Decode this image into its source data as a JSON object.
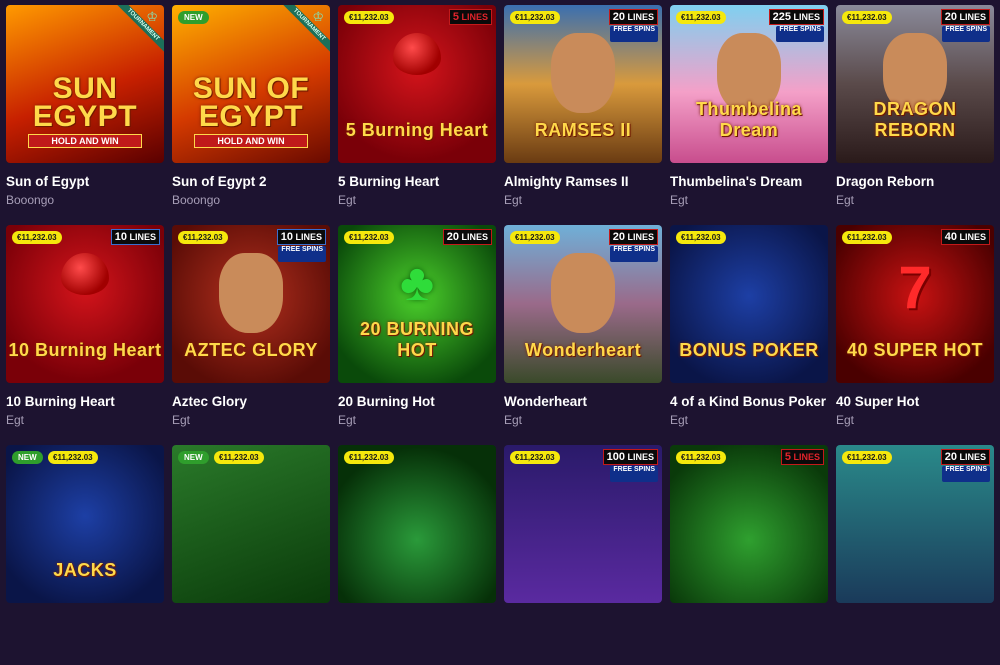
{
  "games": [
    {
      "title": "Sun of Egypt",
      "provider": "Booongo",
      "logo": "SUN EGYPT",
      "logo_sub": "HOLD AND WIN",
      "tournament": "TOURNAMENT",
      "bg": "linear-gradient(160deg,#ff9a00,#c72000 55%,#5a0000)"
    },
    {
      "title": "Sun of Egypt 2",
      "provider": "Booongo",
      "logo": "SUN OF EGYPT",
      "logo_sub": "HOLD AND WIN",
      "tournament": "TOURNAMENT",
      "new": "NEW",
      "bg": "linear-gradient(160deg,#ffb000,#d43a00 55%,#6a0a00)"
    },
    {
      "title": "5 Burning Heart",
      "provider": "Egt",
      "jackpot": "€11,232.03",
      "lines_num": "5",
      "lines_word": "LINES",
      "lines_style": "red",
      "logo": "5 Burning Heart",
      "bg": "radial-gradient(circle at 50% 40%,#d4141b,#7a0008 75%)",
      "fig": "heart"
    },
    {
      "title": "Almighty Ramses II",
      "provider": "Egt",
      "jackpot": "€11,232.03",
      "lines_num": "20",
      "lines_word": "LINES",
      "free": "FREE SPINS",
      "logo": "RAMSES II",
      "bg": "linear-gradient(180deg,#3a6fb0,#d99a3c 50%,#6a3b12)",
      "fig": "face"
    },
    {
      "title": "Thumbelina's Dream",
      "provider": "Egt",
      "jackpot": "€11,232.03",
      "lines_num": "225",
      "lines_word": "LINES",
      "free": "FREE SPINS",
      "logo": "Thumbelina Dream",
      "bg": "linear-gradient(180deg,#7fd0f0,#f4a0c8 55%,#c84d8d)",
      "fig": "face"
    },
    {
      "title": "Dragon Reborn",
      "provider": "Egt",
      "jackpot": "€11,232.03",
      "lines_num": "20",
      "lines_word": "LINES",
      "free": "FREE SPINS",
      "logo": "DRAGON REBORN",
      "bg": "linear-gradient(180deg,#8a8a9a,#5a4a4a 50%,#2a1a1a)",
      "fig": "face"
    },
    {
      "title": "10 Burning Heart",
      "provider": "Egt",
      "jackpot": "€11,232.03",
      "lines_num": "10",
      "lines_word": "LINES",
      "lines_style": "blue",
      "logo": "10 Burning Heart",
      "bg": "radial-gradient(circle at 50% 40%,#d4141b,#7a0008 75%)",
      "fig": "heart"
    },
    {
      "title": "Aztec Glory",
      "provider": "Egt",
      "jackpot": "€11,232.03",
      "lines_num": "10",
      "lines_word": "LINES",
      "lines_style": "blue",
      "free": "FREE SPINS",
      "logo": "AZTEC GLORY",
      "bg": "radial-gradient(circle at 50% 45%,#b3301e,#5a0c06 80%)",
      "fig": "face"
    },
    {
      "title": "20 Burning Hot",
      "provider": "Egt",
      "jackpot": "€11,232.03",
      "lines_num": "20",
      "lines_word": "LINES",
      "logo": "20 BURNING HOT",
      "bg": "radial-gradient(circle at 50% 45%,#4bd02b,#0a4a0a 80%)",
      "fig": "clover"
    },
    {
      "title": "Wonderheart",
      "provider": "Egt",
      "jackpot": "€11,232.03",
      "lines_num": "20",
      "lines_word": "LINES",
      "free": "FREE SPINS",
      "logo": "Wonderheart",
      "bg": "linear-gradient(180deg,#6fb0d8,#9a6a8a 50%,#3a4a2a)",
      "fig": "face"
    },
    {
      "title": "4 of a Kind Bonus Poker",
      "provider": "Egt",
      "jackpot": "€11,232.03",
      "logo": "BONUS POKER",
      "bg": "radial-gradient(circle at 50% 45%,#1d3fa5,#0a1548 80%)"
    },
    {
      "title": "40 Super Hot",
      "provider": "Egt",
      "jackpot": "€11,232.03",
      "lines_num": "40",
      "lines_word": "LINES",
      "logo": "40 SUPER HOT",
      "bg": "radial-gradient(circle at 50% 45%,#c81212,#4a0000 80%)",
      "fig": "seven"
    },
    {
      "title": "",
      "provider": "",
      "jackpot": "€11,232.03",
      "new": "NEW",
      "logo": "JACKS",
      "bg": "radial-gradient(circle at 50% 45%,#1d3fa5,#0a1548 80%)"
    },
    {
      "title": "",
      "provider": "",
      "jackpot": "€11,232.03",
      "new": "NEW",
      "logo": "",
      "bg": "linear-gradient(160deg,#2a7a2a,#0a3a0a)"
    },
    {
      "title": "",
      "provider": "",
      "jackpot": "€11,232.03",
      "logo": "",
      "bg": "radial-gradient(circle at 50% 60%,#2a9a3a,#063008 75%)"
    },
    {
      "title": "",
      "provider": "",
      "jackpot": "€11,232.03",
      "lines_num": "100",
      "lines_word": "LINES",
      "free": "FREE SPINS",
      "logo": "",
      "bg": "linear-gradient(180deg,#2a1a6a,#5a2aa0)"
    },
    {
      "title": "",
      "provider": "",
      "jackpot": "€11,232.03",
      "lines_num": "5",
      "lines_word": "LINES",
      "lines_style": "red",
      "logo": "",
      "bg": "radial-gradient(circle at 50% 60%,#2fa02f,#0a3a0a 80%)"
    },
    {
      "title": "",
      "provider": "",
      "jackpot": "€11,232.03",
      "lines_num": "20",
      "lines_word": "LINES",
      "free": "FREE SPINS",
      "logo": "",
      "bg": "linear-gradient(180deg,#2a8a8a,#1a3a5a)"
    }
  ]
}
